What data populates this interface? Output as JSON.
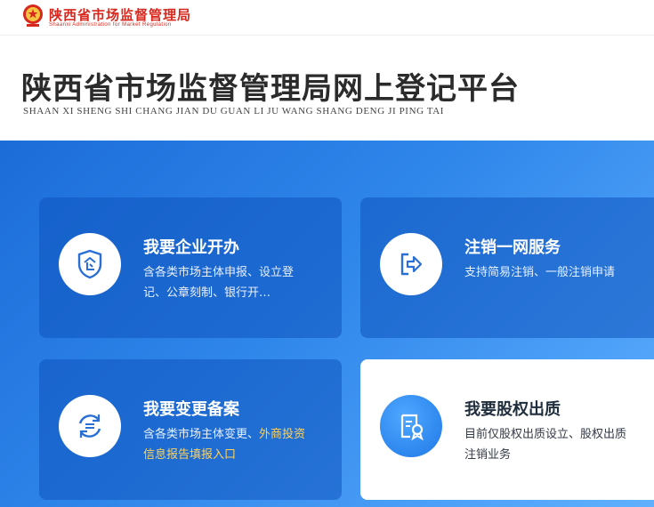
{
  "header": {
    "brand_cn": "陕西省市场监督管理局",
    "brand_en": "Shaanxi Administration for Market Regulation",
    "emblem_icon": "national-emblem-icon",
    "accent_color": "#d8281e"
  },
  "title": {
    "cn": "陕西省市场监督管理局网上登记平台",
    "en": "SHAAN XI SHENG SHI CHANG JIAN DU GUAN LI JU WANG SHANG DENG JI PING TAI"
  },
  "cards": [
    {
      "title": "我要企业开办",
      "desc": "含各类市场主体申报、设立登记、公章刻制、银行开…",
      "icon": "enterprise-shield-icon"
    },
    {
      "title": "注销一网服务",
      "desc": "支持简易注销、一般注销申请",
      "icon": "logout-exit-icon"
    },
    {
      "title": "我要变更备案",
      "desc_main": "含各类市场主体变更、",
      "desc_highlight": "外商投资信息报告填报入口",
      "icon": "change-refresh-icon"
    },
    {
      "title": "我要股权出质",
      "desc": "目前仅股权出质设立、股权出质注销业务",
      "icon": "equity-certificate-icon"
    }
  ],
  "colors": {
    "hero_gradient_start": "#1c6cd8",
    "hero_gradient_end": "#5fb0ff",
    "highlight": "#ffd35a"
  }
}
